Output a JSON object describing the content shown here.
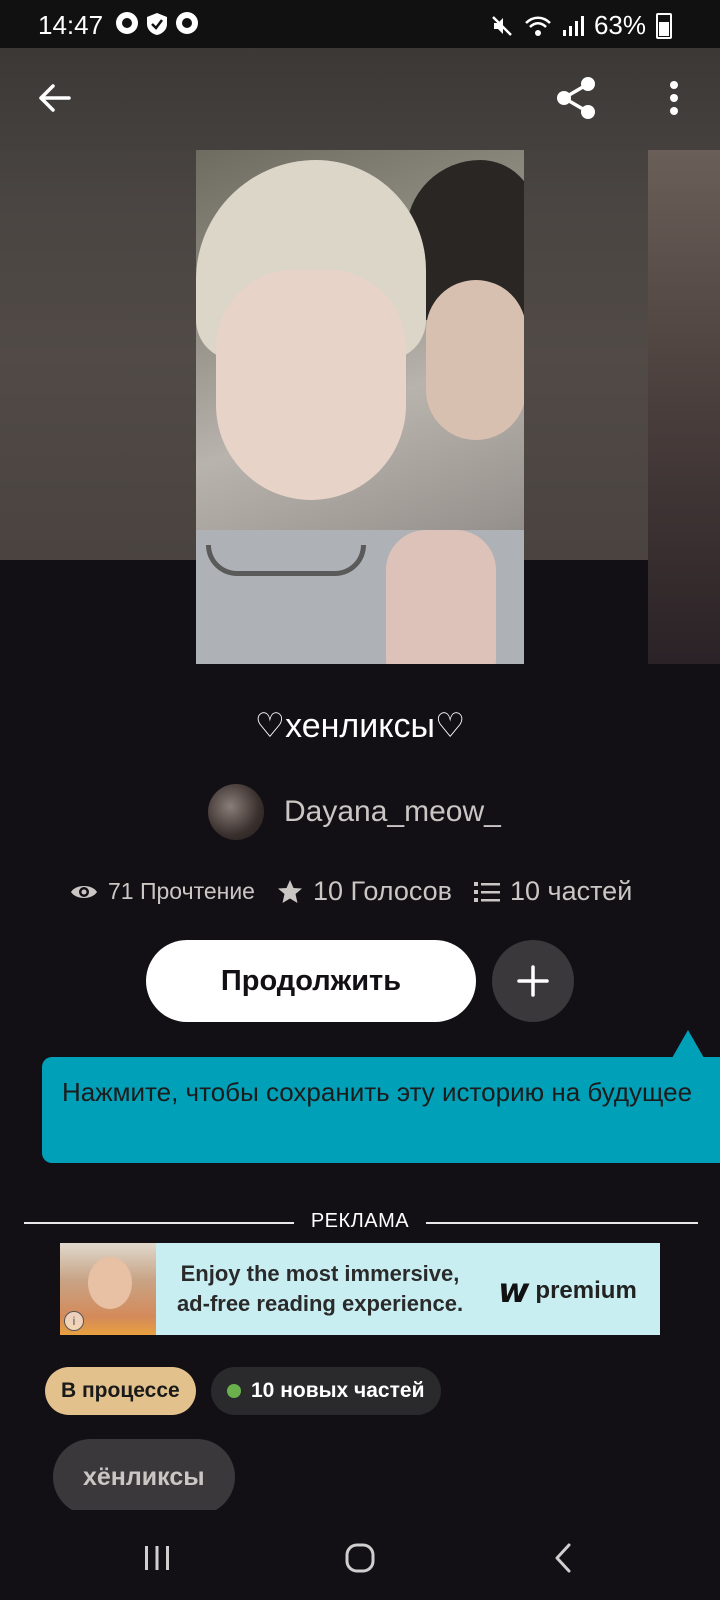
{
  "status_bar": {
    "time": "14:47",
    "battery": "63%",
    "icons_left": [
      "chrome-icon",
      "shield-check-icon",
      "chrome-icon"
    ],
    "icons_right": [
      "mute-icon",
      "wifi-icon",
      "signal-icon",
      "battery-icon"
    ]
  },
  "header": {
    "icons": [
      "back-arrow-icon",
      "share-icon",
      "more-vertical-icon"
    ]
  },
  "story": {
    "title": "♡хенликсы♡",
    "author": "Dayana_meow_",
    "stats": {
      "reads": "71 Прочтение",
      "votes": "10 Голосов",
      "parts": "10 частей"
    }
  },
  "actions": {
    "continue_label": "Продолжить",
    "add_icon": "plus-icon"
  },
  "tooltip": {
    "text": "Нажмите, чтобы сохранить эту историю на будущее"
  },
  "ad": {
    "label": "РЕКЛАМА",
    "line1": "Enjoy the most immersive,",
    "line2": "ad-free reading experience.",
    "brand_mark": "w",
    "brand": "premium",
    "info": "i"
  },
  "tags": {
    "status": "В процессе",
    "new_parts": "10 новых частей",
    "genre": "хёнликсы"
  },
  "colors": {
    "background": "#121014",
    "tooltip": "#00a0b8",
    "status_tag": "#e2c18c",
    "new_dot": "#6ab04c"
  },
  "nav_bar": {
    "icons": [
      "recents-icon",
      "home-icon",
      "back-icon"
    ]
  }
}
